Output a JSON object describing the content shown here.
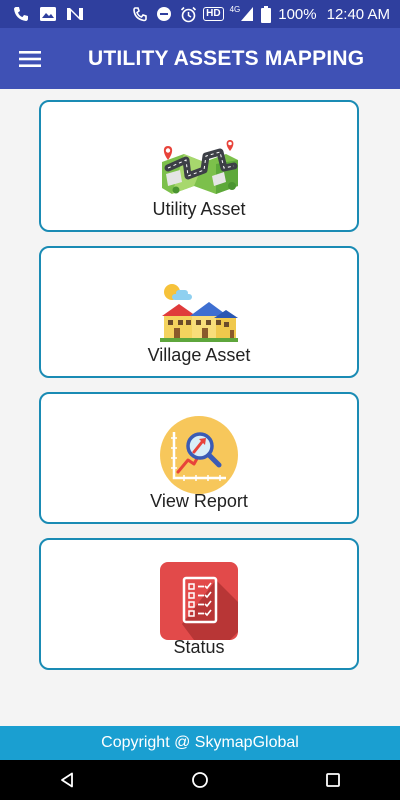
{
  "status_bar": {
    "battery_text": "100%",
    "time": "12:40 AM",
    "hd_badge": "HD",
    "network": "4G"
  },
  "app_bar": {
    "title": "UTILITY ASSETS MAPPING"
  },
  "menu": [
    {
      "label": "Utility Asset",
      "icon": "map-route-icon"
    },
    {
      "label": "Village Asset",
      "icon": "village-houses-icon"
    },
    {
      "label": "View Report",
      "icon": "report-chart-icon"
    },
    {
      "label": "Status",
      "icon": "checklist-icon"
    }
  ],
  "footer": {
    "text": "Copyright @ SkymapGlobal"
  },
  "colors": {
    "status_bar": "#2f3f9e",
    "app_bar": "#3f51b5",
    "card_border": "#1a8bb4",
    "footer": "#1a9fd1"
  }
}
